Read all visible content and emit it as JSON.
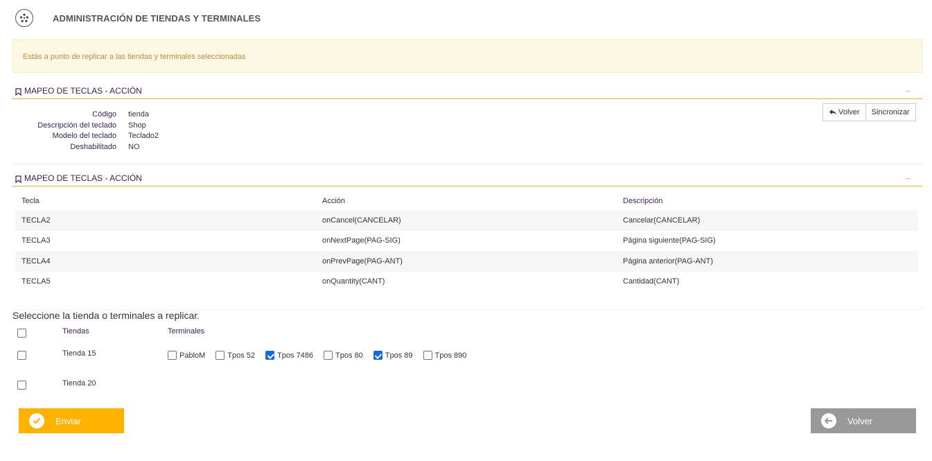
{
  "header": {
    "title": "ADMINISTRACIÓN DE TIENDAS Y TERMINALES",
    "logo_icon": "asterisk-logo-icon"
  },
  "alert": {
    "text": "Estás a punto de replicar a las tiendas y terminales seleccionadas"
  },
  "section1": {
    "title": "MAPEO DE TECLAS - ACCIÓN",
    "minimize": "_"
  },
  "keyboard_info": [
    {
      "label": "Código",
      "value": "tienda"
    },
    {
      "label": "Descripción del teclado",
      "value": "Shop"
    },
    {
      "label": "Modelo del teclado",
      "value": "Teclado2"
    },
    {
      "label": "Deshabilitado",
      "value": "NO"
    }
  ],
  "actions": {
    "back_label": "Volver",
    "sync_label": "Sincronizar"
  },
  "section2": {
    "title": "MAPEO DE TECLAS - ACCIÓN",
    "minimize": "_"
  },
  "table": {
    "headers": [
      "Tecla",
      "Acción",
      "Descripción"
    ],
    "rows": [
      [
        "TECLA2",
        "onCancel(CANCELAR)",
        "Cancelar(CANCELAR)"
      ],
      [
        "TECLA3",
        "onNextPage(PAG-SIG)",
        "Página siguiente(PAG-SIG)"
      ],
      [
        "TECLA4",
        "onPrevPage(PAG-ANT)",
        "Página anterior(PAG-ANT)"
      ],
      [
        "TECLA5",
        "onQuantity(CANT)",
        "Cantidad(CANT)"
      ]
    ]
  },
  "replicate": {
    "title": "Seleccione la tienda o terminales a replicar.",
    "col_stores": "Tiendas",
    "col_terminals": "Terminales",
    "stores": [
      {
        "name": "Tienda 15",
        "checked": false,
        "terminals": [
          {
            "name": "PabloM",
            "checked": false
          },
          {
            "name": "Tpos 52",
            "checked": false
          },
          {
            "name": "Tpos 7486",
            "checked": true
          },
          {
            "name": "Tpos 80",
            "checked": false
          },
          {
            "name": "Tpos 89",
            "checked": true
          },
          {
            "name": "Tpos 890",
            "checked": false
          }
        ]
      },
      {
        "name": "Tienda 20",
        "checked": false,
        "terminals": []
      }
    ]
  },
  "footer": {
    "send_label": "Enviar",
    "back_label": "Volver"
  },
  "colors": {
    "accent": "#ffb300",
    "section_line": "#e1b22a",
    "label": "#3a1d55",
    "alert_bg": "#fcf8e3",
    "alert_text": "#c6893f",
    "checkbox_checked": "#0f6bd9",
    "back_button": "#999999"
  }
}
